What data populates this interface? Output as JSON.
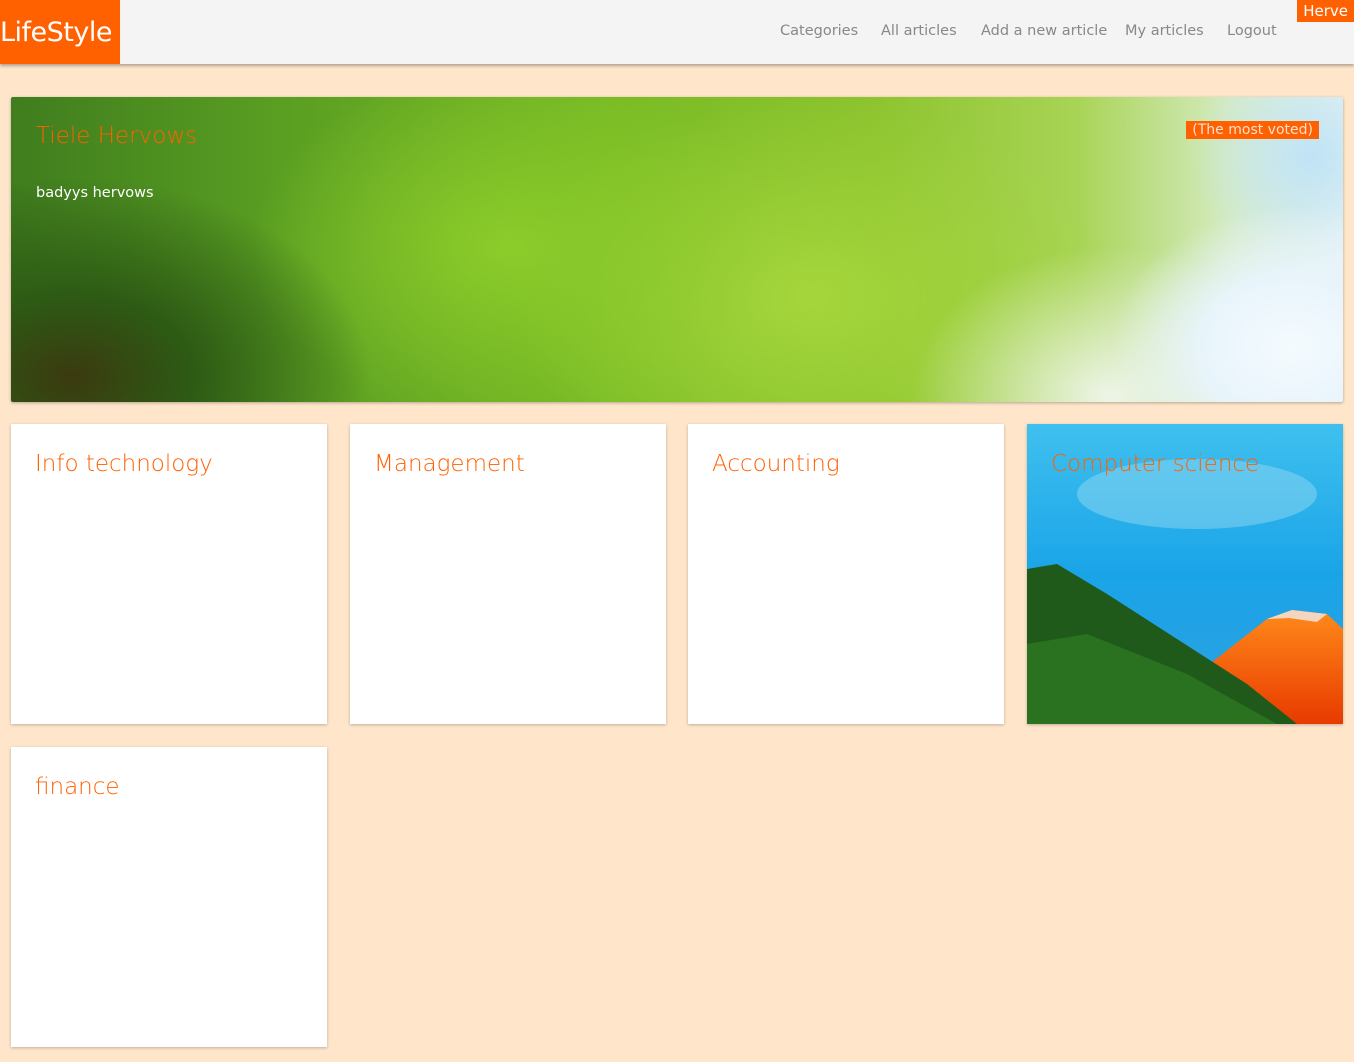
{
  "brand": "LifeStyle",
  "nav": [
    "Categories",
    "All articles",
    "Add a new article",
    "My articles",
    "Logout"
  ],
  "user": "Herve",
  "featured": {
    "title": "Tiele Hervows",
    "body": "badyys hervows",
    "badge": "(The most voted)"
  },
  "categories": [
    {
      "title": "Info technology"
    },
    {
      "title": "Management"
    },
    {
      "title": "Accounting"
    },
    {
      "title": "Computer science"
    },
    {
      "title": "finance"
    }
  ],
  "colors": {
    "accent": "#ff6000",
    "background": "#ffe6cb",
    "navbar": "#f4f4f4"
  }
}
